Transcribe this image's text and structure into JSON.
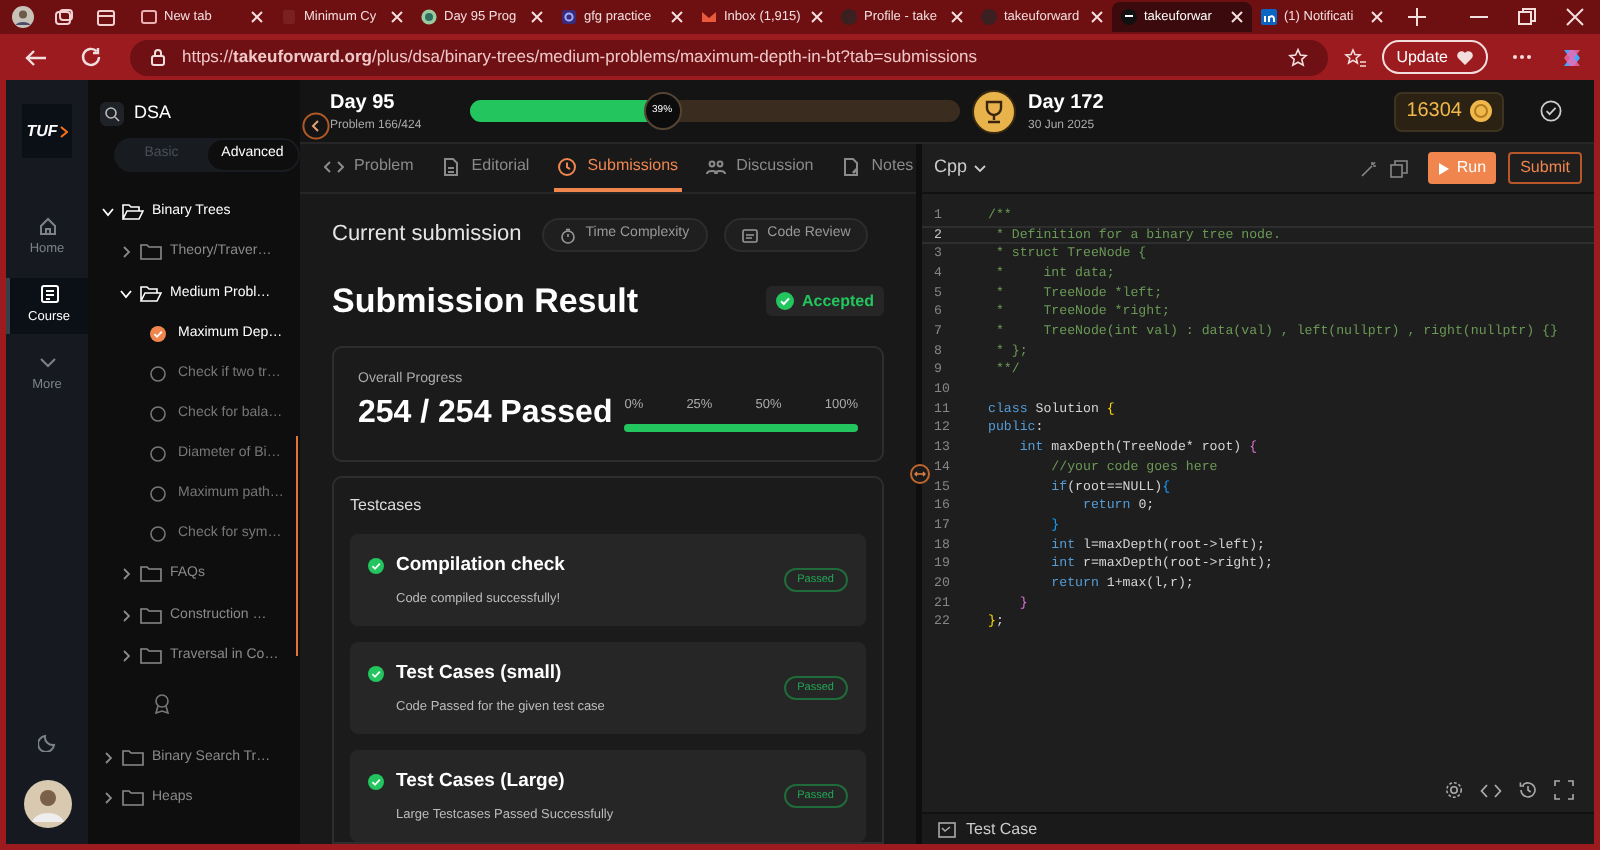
{
  "browser": {
    "tabs": [
      {
        "label": "New tab",
        "selected": false
      },
      {
        "label": "Minimum Cy",
        "selected": false
      },
      {
        "label": "Day 95 Prog",
        "selected": false
      },
      {
        "label": "gfg practice",
        "selected": false
      },
      {
        "label": "Inbox (1,915)",
        "selected": false
      },
      {
        "label": "Profile - take",
        "selected": false
      },
      {
        "label": "takeuforward",
        "selected": false
      },
      {
        "label": "takeuforwar",
        "selected": true
      },
      {
        "label": "(1) Notificati",
        "selected": false
      }
    ],
    "url": "https://**takeuforward.org**/plus/dsa/binary-trees/medium-problems/maximum-depth-in-bt?tab=submissions",
    "update_button": "Update"
  },
  "nav": {
    "logo": "TUF",
    "items": [
      {
        "label": "Home",
        "selected": false
      },
      {
        "label": "Course",
        "selected": true
      },
      {
        "label": "More",
        "selected": false
      }
    ]
  },
  "tree": {
    "search": "DSA",
    "modes": [
      {
        "label": "Basic",
        "selected": false
      },
      {
        "label": "Advanced",
        "selected": true
      }
    ],
    "items": [
      {
        "kind": "folder",
        "label": "Binary Trees",
        "expanded": true,
        "children": [
          {
            "kind": "folder",
            "label": "Theory/Traver…",
            "expanded": false
          },
          {
            "kind": "folder",
            "label": "Medium Probl…",
            "expanded": true,
            "children": [
              {
                "kind": "problem",
                "label": "Maximum Dep…",
                "checked": true,
                "selected": true
              },
              {
                "kind": "problem",
                "label": "Check if two tr…",
                "checked": false,
                "selected": false
              },
              {
                "kind": "problem",
                "label": "Check for bala…",
                "checked": false,
                "selected": false
              },
              {
                "kind": "problem",
                "label": "Diameter of Bi…",
                "checked": false,
                "selected": false
              },
              {
                "kind": "problem",
                "label": "Maximum path…",
                "checked": false,
                "selected": false
              },
              {
                "kind": "problem",
                "label": "Check for sym…",
                "checked": false,
                "selected": false
              }
            ]
          },
          {
            "kind": "folder",
            "label": "FAQs",
            "expanded": false
          },
          {
            "kind": "folder",
            "label": "Construction …",
            "expanded": false
          },
          {
            "kind": "folder",
            "label": "Traversal in Co…",
            "expanded": false
          },
          {
            "kind": "award"
          }
        ]
      },
      {
        "kind": "folder",
        "label": "Binary Search Tr…",
        "expanded": false
      },
      {
        "kind": "folder",
        "label": "Heaps",
        "expanded": false
      }
    ]
  },
  "header": {
    "day": "Day 95",
    "problem": "Problem 166/424",
    "level": 0.39,
    "percent": "39%",
    "goal_day": "Day 172",
    "goal_date": "30 Jun 2025",
    "points": "16304"
  },
  "tabs": [
    {
      "label": "Problem",
      "selected": false
    },
    {
      "label": "Editorial",
      "selected": false
    },
    {
      "label": "Submissions",
      "selected": true
    },
    {
      "label": "Discussion",
      "selected": false
    },
    {
      "label": "Notes",
      "selected": false
    }
  ],
  "submission": {
    "heading": "Current submission",
    "chips": [
      "Time Complexity",
      "Code Review"
    ],
    "title": "Submission Result",
    "status": "Accepted",
    "progress": {
      "label": "Overall Progress",
      "result": "254 / 254 Passed",
      "ticks": [
        "0%",
        "25%",
        "50%",
        "100%"
      ],
      "level": 1
    },
    "testcases_title": "Testcases",
    "testcases": [
      {
        "title": "Compilation check",
        "description": "Code compiled successfully!",
        "badge": "Passed"
      },
      {
        "title": "Test Cases (small)",
        "description": "Code Passed for the given test case",
        "badge": "Passed"
      },
      {
        "title": "Test Cases (Large)",
        "description": "Large Testcases Passed Successfully",
        "badge": "Passed"
      }
    ]
  },
  "editor": {
    "language": "Cpp",
    "run": "Run",
    "submit": "Submit",
    "test_case": "Test Case",
    "lines": [
      {
        "number": "1",
        "current": false,
        "segments": [
          {
            "text": "/**",
            "kind": "comment"
          }
        ]
      },
      {
        "number": "2",
        "current": true,
        "segments": [
          {
            "text": " * Definition for a binary tree node.",
            "kind": "comment"
          }
        ]
      },
      {
        "number": "3",
        "current": false,
        "segments": [
          {
            "text": " * struct TreeNode {",
            "kind": "comment"
          }
        ]
      },
      {
        "number": "4",
        "current": false,
        "segments": [
          {
            "text": " *     int data;",
            "kind": "comment"
          }
        ]
      },
      {
        "number": "5",
        "current": false,
        "segments": [
          {
            "text": " *     TreeNode *left;",
            "kind": "comment"
          }
        ]
      },
      {
        "number": "6",
        "current": false,
        "segments": [
          {
            "text": " *     TreeNode *right;",
            "kind": "comment"
          }
        ]
      },
      {
        "number": "7",
        "current": false,
        "segments": [
          {
            "text": " *     TreeNode(int val) : data(val) , left(nullptr) , right(nullptr) {}",
            "kind": "comment"
          }
        ]
      },
      {
        "number": "8",
        "current": false,
        "segments": [
          {
            "text": " * };",
            "kind": "comment"
          }
        ]
      },
      {
        "number": "9",
        "current": false,
        "segments": [
          {
            "text": " **/",
            "kind": "comment"
          }
        ]
      },
      {
        "number": "10",
        "current": false
      },
      {
        "number": "11",
        "current": false,
        "segments": [
          {
            "text": "class",
            "kind": "keyword"
          },
          {
            "text": " Solution ",
            "kind": "plain"
          },
          {
            "text": "{",
            "kind": "brace1"
          }
        ]
      },
      {
        "number": "12",
        "current": false,
        "segments": [
          {
            "text": "public",
            "kind": "keyword"
          },
          {
            "text": ":",
            "kind": "plain"
          }
        ]
      },
      {
        "number": "13",
        "current": false,
        "segments": [
          {
            "text": "    int",
            "kind": "keyword"
          },
          {
            "text": " maxDepth(TreeNode* root) ",
            "kind": "plain"
          },
          {
            "text": "{",
            "kind": "brace2"
          }
        ]
      },
      {
        "number": "14",
        "current": false,
        "segments": [
          {
            "text": "        //your code goes here",
            "kind": "comment"
          }
        ]
      },
      {
        "number": "15",
        "current": false,
        "segments": [
          {
            "text": "        if",
            "kind": "keyword"
          },
          {
            "text": "(root==NULL)",
            "kind": "plain"
          },
          {
            "text": "{",
            "kind": "brace3"
          }
        ]
      },
      {
        "number": "16",
        "current": false,
        "segments": [
          {
            "text": "            return",
            "kind": "keyword"
          },
          {
            "text": " 0;",
            "kind": "plain"
          }
        ]
      },
      {
        "number": "17",
        "current": false,
        "segments": [
          {
            "text": "        }",
            "kind": "brace3"
          }
        ]
      },
      {
        "number": "18",
        "current": false,
        "segments": [
          {
            "text": "        int",
            "kind": "keyword"
          },
          {
            "text": " l=maxDepth(root->left);",
            "kind": "plain"
          }
        ]
      },
      {
        "number": "19",
        "current": false,
        "segments": [
          {
            "text": "        int",
            "kind": "keyword"
          },
          {
            "text": " r=maxDepth(root->right);",
            "kind": "plain"
          }
        ]
      },
      {
        "number": "20",
        "current": false,
        "segments": [
          {
            "text": "        return",
            "kind": "keyword"
          },
          {
            "text": " 1+max(l,r);",
            "kind": "plain"
          }
        ]
      },
      {
        "number": "21",
        "current": false,
        "segments": [
          {
            "text": "    }",
            "kind": "brace2"
          }
        ]
      },
      {
        "number": "22",
        "current": false,
        "segments": [
          {
            "text": "}",
            "kind": "brace1"
          },
          {
            "text": ";",
            "kind": "plain"
          }
        ]
      }
    ]
  }
}
